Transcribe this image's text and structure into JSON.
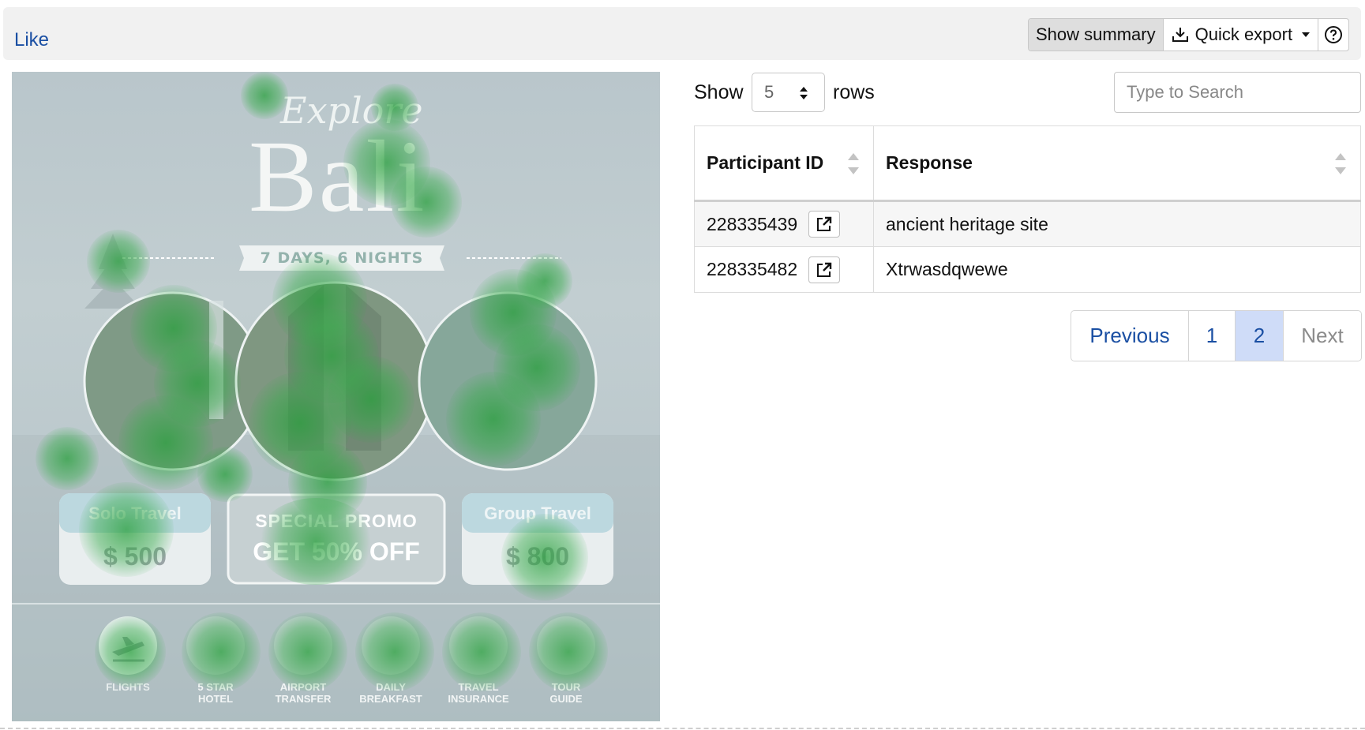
{
  "toolbar": {
    "like_label": "Like",
    "show_summary_label": "Show summary",
    "quick_export_label": "Quick export"
  },
  "poster": {
    "script_title": "Explore",
    "main_title": "Bali",
    "duration": "7 DAYS, 6 NIGHTS",
    "solo_title": "Solo Travel",
    "solo_price": "$ 500",
    "promo_title": "SPECIAL PROMO",
    "promo_offer": "GET 50% OFF",
    "group_title": "Group Travel",
    "group_price": "$ 800",
    "features": [
      {
        "line1": "FLIGHTS",
        "line2": ""
      },
      {
        "line1": "5 STAR",
        "line2": "HOTEL"
      },
      {
        "line1": "AIRPORT",
        "line2": "TRANSFER"
      },
      {
        "line1": "DAILY",
        "line2": "BREAKFAST"
      },
      {
        "line1": "TRAVEL",
        "line2": "INSURANCE"
      },
      {
        "line1": "TOUR",
        "line2": "GUIDE"
      }
    ]
  },
  "table_controls": {
    "show_label": "Show",
    "rows_label": "rows",
    "page_length": "5",
    "search_placeholder": "Type to Search"
  },
  "table": {
    "columns": [
      "Participant ID",
      "Response"
    ],
    "rows": [
      {
        "participant_id": "228335439",
        "response": "ancient heritage site"
      },
      {
        "participant_id": "228335482",
        "response": "Xtrwasdqwewe"
      }
    ]
  },
  "pagination": {
    "previous": "Previous",
    "pages": [
      "1",
      "2"
    ],
    "current_page": "2",
    "next": "Next"
  },
  "colors": {
    "link": "#1a4fa3",
    "active_page": "#cfdcf8",
    "heatmap": "#2fa046"
  }
}
